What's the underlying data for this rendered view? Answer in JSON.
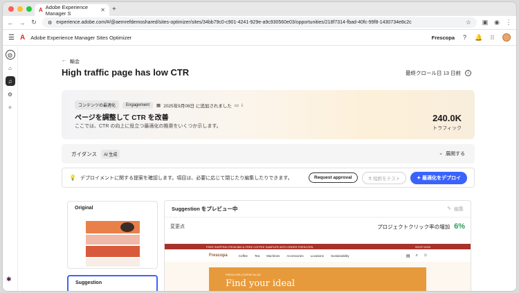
{
  "browser": {
    "tab_title": "Adobe Experience Manager S",
    "url": "experience.adobe.com/#/@aemrefdemoshared/sites-optimizer/sites/34bb79c0-c901-4241-929e-a9c930560e03/opportunities/218f7314-fbad-40fc-99f8-1430734e8c2c"
  },
  "app": {
    "title": "Adobe Experience Manager Sites Optimizer",
    "org": "Frescopa"
  },
  "page": {
    "back_label": "輸会",
    "title": "High traffic page has low CTR",
    "last_crawl": "最終クロール日 13 日前"
  },
  "hero": {
    "badges": [
      "コンテンツの最適化",
      "Engagement"
    ],
    "date_added": "2025年9月08日 に追加されました",
    "heading": "ページを調整して CTR を改善",
    "subtext": "ここでは、CTR の向上に役立つ最適化の推奨をいくつか示します。",
    "metric_value": "240.0K",
    "metric_label": "トラフィック"
  },
  "guidance": {
    "label": "ガイダンス",
    "ai_badge": "AI 生成",
    "expand_label": "展開する"
  },
  "deploy": {
    "message": "デプロイメントに関する提案を確認します。項目は、必要に応じて閉じたり編集したりできます。",
    "request_approval": "Request approval",
    "test_label": "短酢をテスト",
    "deploy_label": "最適化をデプロイ"
  },
  "variations": {
    "original": "Original",
    "suggestion": "Suggestion"
  },
  "preview": {
    "title": "Suggestion をプレビュー中",
    "edit_label": "編集",
    "changes_label": "変更点",
    "metric_label": "プロジェクトクリック率の増加",
    "metric_value": "6%"
  },
  "site_preview": {
    "promo": "FREE SHIPPING FROM $50 & FREE COFFEE SAMPLER WITH ORDER FRESCOPA",
    "shop_now": "SHOP NOW",
    "brand": "Frescopa",
    "nav": [
      "Coffee",
      "Tea",
      "Machines",
      "Accessories",
      "Locations",
      "Sustainability"
    ],
    "eyebrow": "FRESCOPA COFFEE BLOG",
    "headline": "Find your ideal"
  },
  "colors": {
    "accent": "#3b63fb",
    "success": "#2d9d5c",
    "adobe_red": "#e1251b"
  }
}
